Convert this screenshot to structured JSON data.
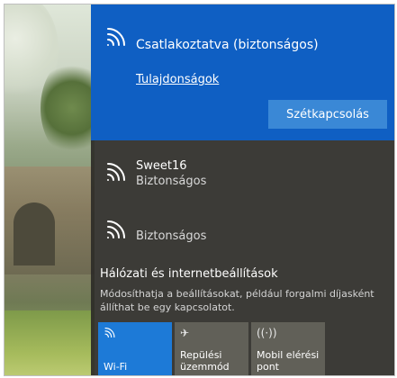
{
  "connected_network": {
    "status": "Csatlakoztatva (biztonságos)",
    "properties_link": "Tulajdonságok",
    "disconnect_label": "Szétkapcsolás",
    "icon": "wifi-signal-icon"
  },
  "networks": [
    {
      "name": "Sweet16",
      "security": "Biztonságos",
      "icon": "wifi-signal-icon"
    },
    {
      "name": "",
      "security": "Biztonságos",
      "icon": "wifi-signal-icon"
    }
  ],
  "settings": {
    "title": "Hálózati és internetbeállítások",
    "description": "Módosíthatja a beállításokat, például forgalmi díjasként állíthat be egy kapcsolatot."
  },
  "quick_actions": [
    {
      "label": "Wi-Fi",
      "icon": "wifi-icon",
      "active": true
    },
    {
      "label": "Repülési üzemmód",
      "icon": "airplane-icon",
      "active": false
    },
    {
      "label": "Mobil elérési pont",
      "icon": "mobile-hotspot-icon",
      "active": false
    }
  ],
  "colors": {
    "accent": "#0f5fc3",
    "button": "#3a88d6",
    "panel": "#2d2c28",
    "tile": "#616058",
    "tile_active": "#1d7ad7"
  }
}
